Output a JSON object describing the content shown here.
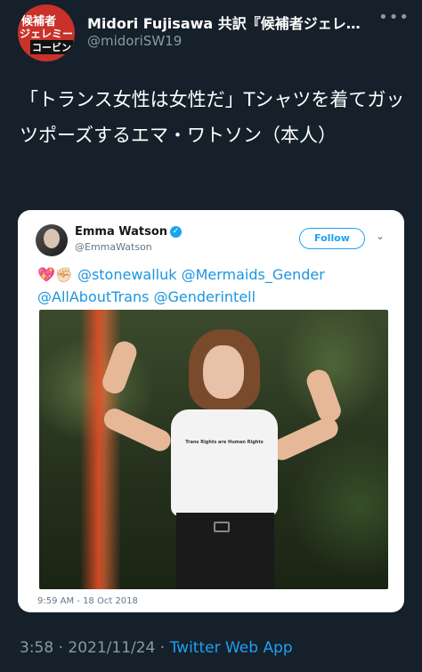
{
  "tweet": {
    "author_name": "Midori Fujisawa 共訳『候補者ジェレ…",
    "author_handle": "@midoriSW19",
    "avatar_lines": [
      "候補者",
      "ジェレミー",
      "コービン"
    ],
    "text": "「トランス女性は女性だ」Tシャツを着てガッツポーズするエマ・ワトソン（本人）",
    "timestamp": "3:58 · 2021/11/24 ·",
    "source": "Twitter Web App",
    "more_icon": "more-horizontal-icon"
  },
  "embedded": {
    "author_name": "Emma Watson",
    "author_handle": "@EmmaWatson",
    "follow_label": "Follow",
    "emoji": "💖✊🏻",
    "text_line1": "@stonewalluk @Mermaids_Gender",
    "text_line2": "@AllAboutTrans @Genderintell",
    "shirt_text": "Trans Rights are Human Rights",
    "time": "9:59 AM - 18 Oct 2018"
  },
  "colors": {
    "background": "#15202b",
    "link": "#1da1f2",
    "muted": "#8b98a5"
  }
}
